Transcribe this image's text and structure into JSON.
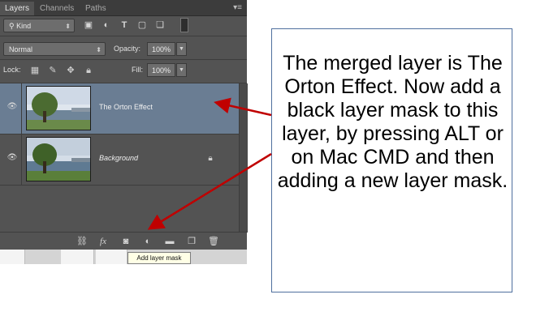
{
  "tabs": {
    "layers": "Layers",
    "channels": "Channels",
    "paths": "Paths"
  },
  "filter": {
    "kind_label": "Kind"
  },
  "blend": {
    "mode": "Normal",
    "opacity_label": "Opacity:",
    "opacity_value": "100%"
  },
  "lock": {
    "label": "Lock:",
    "fill_label": "Fill:",
    "fill_value": "100%"
  },
  "layers": [
    {
      "name": "The Orton Effect",
      "selected": true
    },
    {
      "name": "Background",
      "selected": false,
      "locked": true
    }
  ],
  "tooltip": "Add layer mask",
  "note": {
    "text": "The merged layer is The Orton Effect. Now add a black layer mask to this layer, by pressing ALT or on Mac CMD and then adding a new layer mask."
  },
  "icons": {
    "eye": "eye-icon",
    "lock": "lock-icon",
    "link": "link-icon",
    "fx": "fx-icon",
    "mask": "layer-mask-icon",
    "adjust": "adjustment-layer-icon",
    "folder": "group-folder-icon",
    "new": "new-layer-icon",
    "trash": "trash-icon"
  },
  "colors": {
    "arrow": "#c00000",
    "selected_layer": "#6a7d93",
    "panel": "#535353",
    "note_border": "#4f6f9e"
  }
}
